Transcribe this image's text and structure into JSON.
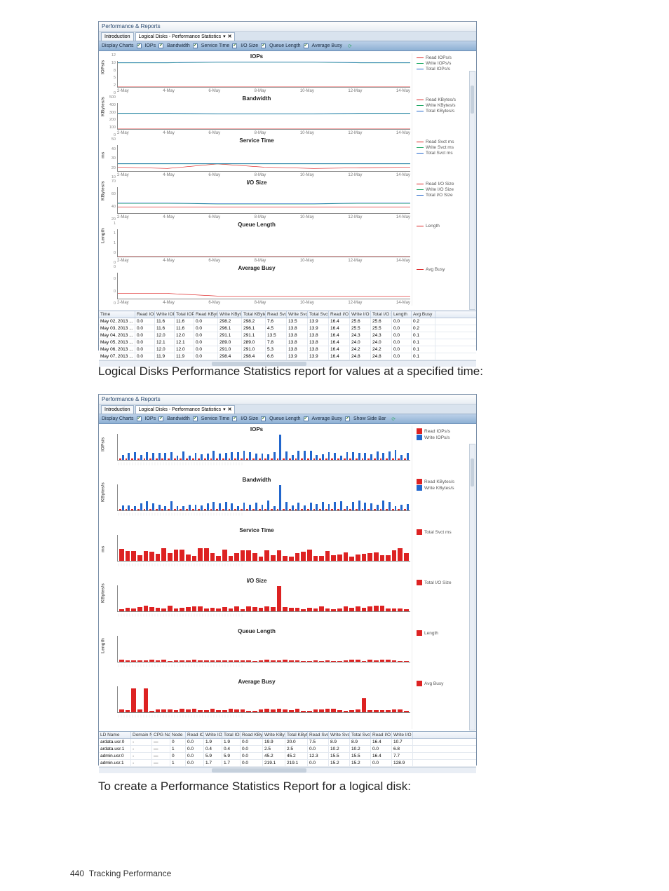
{
  "window_title": "Performance & Reports",
  "tabs": {
    "intro": "Introduction",
    "active": "Logical Disks - Performance Statistics"
  },
  "toolbar": {
    "display_charts": "Display Charts",
    "iops": "IOPs",
    "bandwidth": "Bandwidth",
    "service_time": "Service Time",
    "io_size": "I/O Size",
    "queue_length": "Queue Length",
    "average_busy": "Average Busy",
    "show_side": "Show Side Bar"
  },
  "yaxis": {
    "iops": "IOPs/s",
    "bw": "KBytes/s",
    "svct": "ms",
    "iosize": "KBytes/s",
    "queue": "Length"
  },
  "xticks": [
    "2-May",
    "4-May",
    "6-May",
    "8-May",
    "10-May",
    "12-May",
    "14-May"
  ],
  "legend1": {
    "iops": [
      "Read IOPs/s",
      "Write IOPs/s",
      "Total IOPs/s"
    ],
    "bw": [
      "Read KBytes/s",
      "Write KBytes/s",
      "Total KBytes/s"
    ],
    "svct": [
      "Read Svct ms",
      "Write Svct ms",
      "Total Svct ms"
    ],
    "iosize": [
      "Read I/O Size",
      "Write I/O Size",
      "Total I/O Size"
    ],
    "queue": [
      "Length"
    ],
    "busy": [
      "Avg Busy"
    ]
  },
  "legend2": {
    "iops": [
      "Read IOPs/s",
      "Write IOPs/s"
    ],
    "bw": [
      "Read KBytes/s",
      "Write KBytes/s"
    ],
    "svct": [
      "Total Svct ms"
    ],
    "iosize": [
      "Total I/O Size"
    ],
    "queue": [
      "Length"
    ],
    "busy": [
      "Avg Busy"
    ]
  },
  "chart_data": [
    {
      "type": "line",
      "title": "IOPs",
      "x": [
        "2-May",
        "4-May",
        "6-May",
        "8-May",
        "10-May",
        "12-May",
        "14-May"
      ],
      "series": [
        {
          "name": "Read IOPs/s",
          "values": [
            0,
            0,
            0,
            0,
            0,
            0,
            0
          ]
        },
        {
          "name": "Write IOPs/s",
          "values": [
            11.6,
            11.6,
            12.0,
            12.1,
            12.0,
            11.9,
            11.8
          ]
        },
        {
          "name": "Total IOPs/s",
          "values": [
            11.6,
            11.6,
            12.0,
            12.1,
            12.0,
            11.9,
            11.8
          ]
        }
      ],
      "ylim": [
        0,
        12
      ]
    },
    {
      "type": "line",
      "title": "Bandwidth",
      "x": [
        "2-May",
        "4-May",
        "6-May",
        "8-May",
        "10-May",
        "12-May",
        "14-May"
      ],
      "series": [
        {
          "name": "Read KBytes/s",
          "values": [
            0.0,
            0.0,
            0.0,
            0.0,
            0.0,
            0.0,
            0.0
          ]
        },
        {
          "name": "Write KBytes/s",
          "values": [
            298.2,
            296.1,
            291.1,
            289.0,
            291.0,
            298.4,
            295.0
          ]
        },
        {
          "name": "Total KBytes/s",
          "values": [
            298.2,
            296.1,
            291.1,
            289.0,
            291.0,
            298.4,
            295.0
          ]
        }
      ],
      "ylim": [
        0,
        500
      ]
    },
    {
      "type": "line",
      "title": "Service Time",
      "x": [
        "2-May",
        "4-May",
        "6-May",
        "8-May",
        "10-May",
        "12-May",
        "14-May"
      ],
      "series": [
        {
          "name": "Read Svct ms",
          "values": [
            7.6,
            4.5,
            13.5,
            7.8,
            5.3,
            6.6,
            7.0
          ]
        },
        {
          "name": "Write Svct ms",
          "values": [
            13.5,
            13.8,
            13.8,
            13.8,
            13.8,
            13.9,
            13.8
          ]
        },
        {
          "name": "Total Svct ms",
          "values": [
            13.9,
            13.9,
            13.8,
            13.8,
            13.8,
            13.9,
            13.8
          ]
        }
      ],
      "ylim": [
        0,
        50
      ]
    },
    {
      "type": "line",
      "title": "I/O Size",
      "x": [
        "2-May",
        "4-May",
        "6-May",
        "8-May",
        "10-May",
        "12-May",
        "14-May"
      ],
      "series": [
        {
          "name": "Read I/O Size",
          "values": [
            16.4,
            16.4,
            16.4,
            16.4,
            16.4,
            16.4,
            16.4
          ]
        },
        {
          "name": "Write I/O Size",
          "values": [
            25.6,
            25.5,
            24.3,
            24.0,
            24.2,
            24.8,
            24.5
          ]
        },
        {
          "name": "Total I/O Size",
          "values": [
            25.6,
            25.5,
            24.3,
            24.0,
            24.2,
            24.8,
            24.5
          ]
        }
      ],
      "ylim": [
        0,
        70
      ]
    },
    {
      "type": "line",
      "title": "Queue Length",
      "x": [
        "2-May",
        "4-May",
        "6-May",
        "8-May",
        "10-May",
        "12-May",
        "14-May"
      ],
      "series": [
        {
          "name": "Length",
          "values": [
            0.0,
            0.0,
            0.0,
            0.0,
            0.0,
            0.0,
            0.0
          ]
        }
      ],
      "ylim": [
        0,
        1
      ]
    },
    {
      "type": "line",
      "title": "Average Busy",
      "x": [
        "2-May",
        "4-May",
        "6-May",
        "8-May",
        "10-May",
        "12-May",
        "14-May"
      ],
      "series": [
        {
          "name": "Avg Busy",
          "values": [
            0.2,
            0.2,
            0.1,
            0.1,
            0.1,
            0.1,
            0.1
          ]
        }
      ],
      "ylim": [
        0,
        1
      ]
    }
  ],
  "grid1": {
    "headers": [
      "Time",
      "Read IOPs/s",
      "Write IOPs/s",
      "Total IOPs/s",
      "Read KBytes/s",
      "Write KBytes/s",
      "Total KBytes/s",
      "Read Svct ms",
      "Write Svct ms",
      "Total Svct ms",
      "Read I/O Size",
      "Write I/O Size",
      "Total I/O Size",
      "Length",
      "Avg Busy"
    ],
    "rows": [
      [
        "May 02, 2013 ...",
        "0.0",
        "11.6",
        "11.6",
        "0.0",
        "298.2",
        "298.2",
        "7.6",
        "13.5",
        "13.9",
        "16.4",
        "25.6",
        "25.6",
        "0.0",
        "0.2"
      ],
      [
        "May 03, 2013 ...",
        "0.0",
        "11.6",
        "11.6",
        "0.0",
        "296.1",
        "296.1",
        "4.5",
        "13.8",
        "13.9",
        "16.4",
        "25.5",
        "25.5",
        "0.0",
        "0.2"
      ],
      [
        "May 04, 2013 ...",
        "0.0",
        "12.0",
        "12.0",
        "0.0",
        "291.1",
        "291.1",
        "13.5",
        "13.8",
        "13.8",
        "16.4",
        "24.3",
        "24.3",
        "0.0",
        "0.1"
      ],
      [
        "May 05, 2013 ...",
        "0.0",
        "12.1",
        "12.1",
        "0.0",
        "289.0",
        "289.0",
        "7.8",
        "13.8",
        "13.8",
        "16.4",
        "24.0",
        "24.0",
        "0.0",
        "0.1"
      ],
      [
        "May 06, 2013 ...",
        "0.0",
        "12.0",
        "12.0",
        "0.0",
        "291.0",
        "291.0",
        "5.3",
        "13.8",
        "13.8",
        "16.4",
        "24.2",
        "24.2",
        "0.0",
        "0.1"
      ],
      [
        "May 07, 2013 ...",
        "0.0",
        "11.9",
        "11.9",
        "0.0",
        "298.4",
        "298.4",
        "6.6",
        "13.9",
        "13.9",
        "16.4",
        "24.8",
        "24.8",
        "0.0",
        "0.1"
      ]
    ]
  },
  "grid2": {
    "headers": [
      "LD Name",
      "Domain Name",
      "CPG Name",
      "Node",
      "Read IOPs/s",
      "Write IOPs/s",
      "Total IOPs/s",
      "Read KBytes/s",
      "Write KBytes/s",
      "Total KBytes/s",
      "Read Svct ms",
      "Write Svct ms",
      "Total Svct ms",
      "Read I/O Size",
      "Write I/O Size"
    ],
    "rows": [
      [
        "ardata.usr.0",
        "-",
        "—",
        "0",
        "0.0",
        "1.9",
        "1.9",
        "0.0",
        "19.9",
        "20.0",
        "7.5",
        "8.9",
        "8.9",
        "16.4",
        "10.7"
      ],
      [
        "ardata.usr.1",
        "-",
        "—",
        "1",
        "0.0",
        "0.4",
        "0.4",
        "0.0",
        "2.5",
        "2.5",
        "0.0",
        "10.2",
        "10.2",
        "0.0",
        "6.8"
      ],
      [
        "admin.usr.0",
        "-",
        "—",
        "0",
        "0.0",
        "5.9",
        "5.9",
        "0.0",
        "45.2",
        "45.2",
        "12.3",
        "15.5",
        "15.5",
        "16.4",
        "7.7"
      ],
      [
        "admin.usr.1",
        "-",
        "—",
        "1",
        "0.0",
        "1.7",
        "1.7",
        "0.0",
        "219.1",
        "219.1",
        "0.0",
        "15.2",
        "15.2",
        "0.0",
        "128.9"
      ]
    ]
  },
  "captions": {
    "c1": "Logical Disks Performance Statistics report for values at a specified time:",
    "c2": "To create a Performance Statistics Report for a logical disk:"
  },
  "footer": {
    "page": "440",
    "section": "Tracking Performance"
  },
  "yticks": {
    "iops": [
      "0",
      "2",
      "5",
      "8",
      "10",
      "12"
    ],
    "bw": [
      "0",
      "100",
      "200",
      "300",
      "400",
      "500"
    ],
    "svct": [
      "10",
      "20",
      "30",
      "40",
      "50"
    ],
    "iosize": [
      "20",
      "40",
      "60",
      "70"
    ],
    "queue": [
      "0",
      "0",
      "1",
      "1",
      "1"
    ],
    "busy": [
      "0",
      "0",
      "0",
      "0"
    ]
  }
}
